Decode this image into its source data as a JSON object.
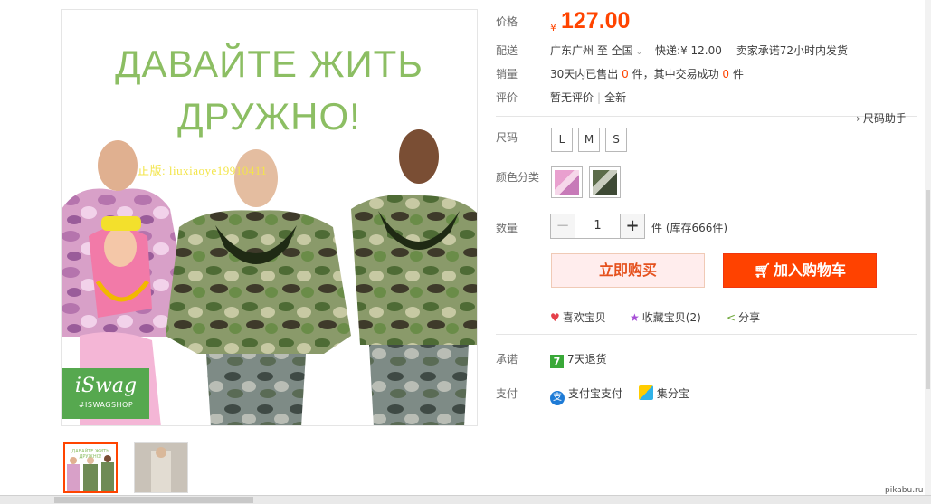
{
  "image": {
    "title_line1": "ДАВАЙТЕ ЖИТЬ",
    "title_line2": "ДРУЖНО!",
    "watermark": "正版: liuxiaoye19910411",
    "brand_name": "iSwag",
    "brand_tag": "#ISWAGSHOP",
    "thumb_title": "ДАВАЙТЕ ЖИТЬ ДРУЖНО!"
  },
  "price": {
    "label": "价格",
    "currency": "¥",
    "amount": "127.00"
  },
  "shipping": {
    "label": "配送",
    "from": "广东广州 至",
    "to": "全国",
    "dropdown_icon": "chevron-down-icon",
    "express": "快递:¥ 12.00",
    "promise": "卖家承诺72小时内发货"
  },
  "sales": {
    "label": "销量",
    "prefix": "30天内已售出",
    "sold": "0",
    "middle": "件，其中交易成功",
    "success": "0",
    "suffix": "件"
  },
  "reviews": {
    "label": "评价",
    "none": "暂无评价",
    "all": "全新"
  },
  "size": {
    "label": "尺码",
    "helper": "尺码助手",
    "options": [
      "L",
      "M",
      "S"
    ]
  },
  "color": {
    "label": "颜色分类"
  },
  "quantity": {
    "label": "数量",
    "minus": "−",
    "value": "1",
    "plus": "+",
    "unit": "件 (库存666件)"
  },
  "buttons": {
    "buy_now": "立即购买",
    "add_to_cart": "加入购物车",
    "cart_icon": "cart-icon"
  },
  "actions": {
    "like": "喜欢宝贝",
    "favorite": "收藏宝贝(2)",
    "share": "分享"
  },
  "promise": {
    "label": "承诺",
    "badge": "7",
    "text": "7天退货"
  },
  "payment": {
    "label": "支付",
    "alipay": "支付宝支付",
    "jifenbao": "集分宝"
  },
  "site_watermark": "pikabu.ru",
  "colors": {
    "accent": "#ff4400",
    "cart_button": "#ff4200",
    "buy_button_bg": "#ffeded",
    "poster_green": "#8cbe63"
  }
}
